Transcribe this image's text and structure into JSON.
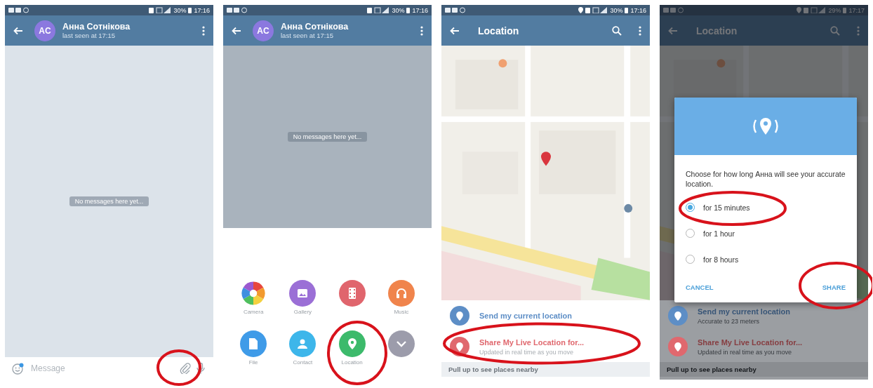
{
  "panels": [
    {
      "kind": "chat",
      "status": {
        "location": false,
        "battery": "30%",
        "time": "17:16"
      },
      "header": {
        "avatar": "AC",
        "title": "Анна Сотнікова",
        "subtitle": "last seen at 17:15"
      },
      "notice": "No messages here yet...",
      "composer": {
        "placeholder": "Message"
      }
    },
    {
      "kind": "attach",
      "status": {
        "location": false,
        "battery": "30%",
        "time": "17:16"
      },
      "header": {
        "avatar": "AC",
        "title": "Анна Сотнікова",
        "subtitle": "last seen at 17:15"
      },
      "notice": "No messages here yet...",
      "attach_items": [
        {
          "kind": "camera",
          "label": "Camera"
        },
        {
          "kind": "gallery",
          "label": "Gallery",
          "color": "#9b6fd6"
        },
        {
          "kind": "video",
          "color": "#e0656d"
        },
        {
          "kind": "music",
          "label": "Music",
          "color": "#f0844c"
        },
        {
          "kind": "file",
          "label": "File",
          "color": "#3f9be8"
        },
        {
          "kind": "contact",
          "label": "Contact",
          "color": "#3db6ea"
        },
        {
          "kind": "location",
          "label": "Location",
          "color": "#3cba6b"
        },
        {
          "kind": "more",
          "color": "#9c9cab"
        }
      ]
    },
    {
      "kind": "location",
      "status": {
        "location": true,
        "battery": "30%",
        "time": "17:16"
      },
      "header": {
        "title": "Location"
      },
      "options": [
        {
          "title": "Send my current location",
          "color": "#5d8ec6"
        },
        {
          "title": "Share My Live Location for...",
          "subtitle": "Updated in real time as you move",
          "color": "#e0686e"
        }
      ],
      "footer": "Pull up to see places nearby"
    },
    {
      "kind": "location",
      "status": {
        "location": true,
        "battery": "29%",
        "time": "17:17"
      },
      "header": {
        "title": "Location"
      },
      "options": [
        {
          "title": "Send my current location",
          "subtitle": "Accurate to 23 meters",
          "color": "#5d8ec6"
        },
        {
          "title": "Share My Live Location for...",
          "subtitle": "Updated in real time as you move",
          "color": "#e0686e"
        }
      ],
      "footer": "Pull up to see places nearby",
      "dialog": {
        "message": "Choose for how long Анна will see your accurate location.",
        "choices": [
          {
            "label": "for 15 minutes",
            "selected": true
          },
          {
            "label": "for 1 hour",
            "selected": false
          },
          {
            "label": "for 8 hours",
            "selected": false
          }
        ],
        "buttons": [
          "CANCEL",
          "SHARE"
        ]
      }
    }
  ]
}
